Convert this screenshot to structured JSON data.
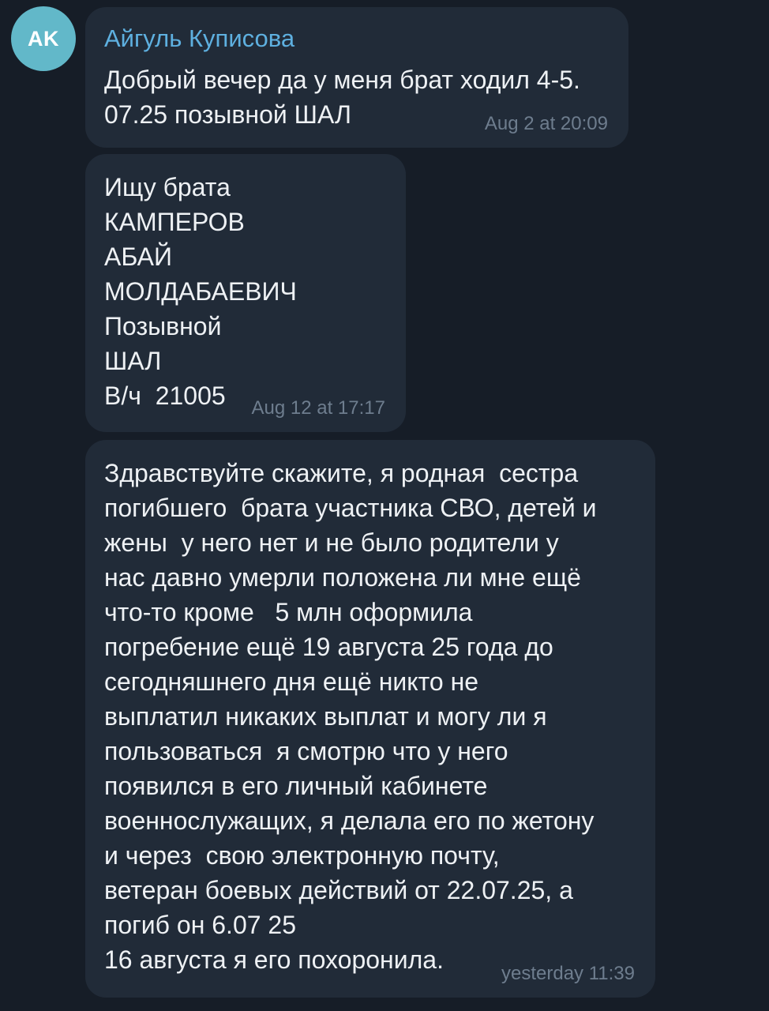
{
  "sender": {
    "initials": "AK",
    "name": "Айгуль Куписова",
    "avatar_color": "#62b8c9",
    "name_color": "#5eb0e0"
  },
  "messages": [
    {
      "text": "Добрый вечер да у меня брат ходил 4-5.\n07.25 позывной ШАЛ",
      "time": "Aug 2 at 20:09"
    },
    {
      "text": "Ищу брата\nКАМПЕРОВ\nАБАЙ\nМОЛДАБАЕВИЧ\nПозывной\nШАЛ\nВ/ч  21005",
      "time": "Aug 12 at 17:17"
    },
    {
      "text": "Здравствуйте скажите, я родная  сестра\nпогибшего  брата участника СВО, детей и\nжены  у него нет и не было родители у\nнас давно умерли положена ли мне ещё\nчто-то кроме   5 млн оформила\nпогребение ещё 19 августа 25 года до\nсегодняшнего дня ещё никто не\nвыплатил никаких выплат и могу ли я\nпользоваться  я смотрю что у него\nпоявился в его личный кабинете\nвоеннослужащих, я делала его по жетону\nи через  свою электронную почту,\nветеран боевых действий от 22.07.25, а\nпогиб он 6.07 25\n16 августа я его похоронила.",
      "time": "yesterday 11:39"
    }
  ],
  "colors": {
    "background": "#161d27",
    "bubble": "#212b38",
    "text": "#eef1f4",
    "timestamp": "#6e7d8e"
  }
}
